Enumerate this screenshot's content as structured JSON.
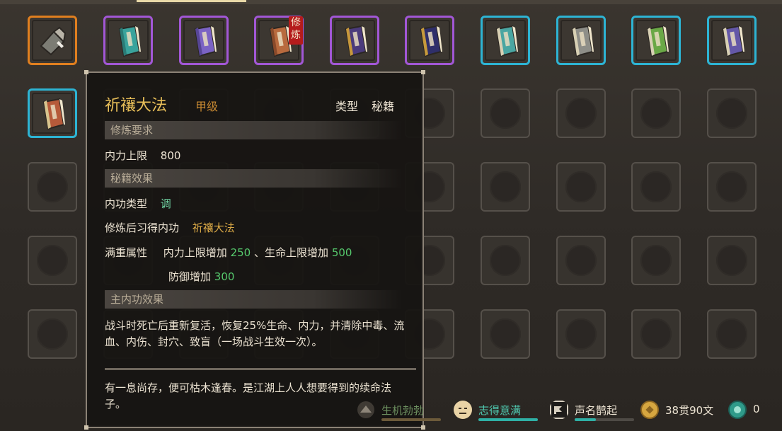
{
  "tooltip": {
    "title": "祈禳大法",
    "grade": "甲级",
    "type_label": "类型",
    "type_value": "秘籍",
    "requirements_header": "修炼要求",
    "requirement_label": "内力上限",
    "requirement_value": "800",
    "effects_header": "秘籍效果",
    "neigong_type_label": "内功类型",
    "neigong_type_value": "调",
    "learn_label": "修炼后习得内功",
    "learn_value": "祈禳大法",
    "full_attr_label": "满重属性",
    "full_attr_line1_a": "内力上限增加",
    "full_attr_line1_b": "250",
    "full_attr_line1_sep": "、生命上限增加",
    "full_attr_line1_c": "500",
    "full_attr_line2_a": "防御增加",
    "full_attr_line2_b": "300",
    "main_effect_header": "主内功效果",
    "main_effect_text": "战斗时死亡后重新复活，恢复25%生命、内力，并清除中毒、流血、内伤、封穴、致盲（一场战斗生效一次）。",
    "flavor_text": "有一息尚存，便可枯木逢春。是江湖上人人想要得到的续命法子。"
  },
  "slot_badge": "修炼",
  "status": {
    "hunger_label": "生机勃勃",
    "mood_label": "志得意满",
    "fame_label": "声名鹊起",
    "money_label": "38贯90文",
    "gems_label": "0"
  },
  "colors": {
    "orange": "#e07f1f",
    "purple": "#a257d6",
    "cyan": "#2db4d4",
    "title_gold": "#e8bf59",
    "green_value": "#56c96d"
  },
  "icons": [
    "weapon-icon",
    "book-icon",
    "scroll-icon",
    "smiley-icon",
    "banner-icon",
    "coin-icon",
    "jade-icon"
  ]
}
